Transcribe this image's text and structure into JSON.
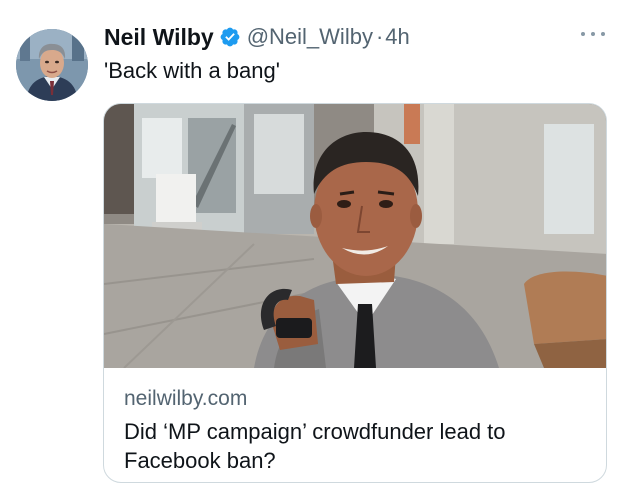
{
  "tweet": {
    "author": {
      "display_name": "Neil Wilby",
      "handle": "@Neil_Wilby",
      "verified": true,
      "avatar_icon": "profile-photo"
    },
    "separator": "·",
    "timestamp": "4h",
    "text": "'Back with a bang'",
    "more_icon": "more-options-icon",
    "card": {
      "domain": "neilwilby.com",
      "title": "Did ‘MP campaign’ crowdfunder lead to Facebook ban?",
      "image_description_icon": "link-preview-photo"
    }
  },
  "colors": {
    "verified_blue": "#1d9bf0",
    "text_primary": "#0f1419",
    "text_secondary": "#536471",
    "card_border": "#cfd9de"
  }
}
